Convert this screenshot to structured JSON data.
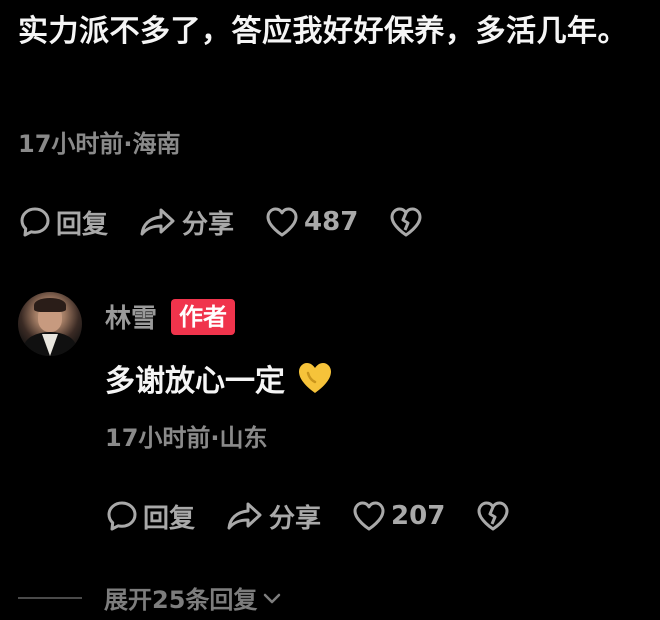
{
  "comment": {
    "text": "实力派不多了，答应我好好保养，多活几年。",
    "meta": "17小时前·海南",
    "actions": {
      "reply_label": "回复",
      "share_label": "分享",
      "like_count": "487"
    }
  },
  "reply": {
    "author": "林雪",
    "badge": "作者",
    "text": "多谢放心一定",
    "emoji": "yellow-heart-icon",
    "meta": "17小时前·山东",
    "actions": {
      "reply_label": "回复",
      "share_label": "分享",
      "like_count": "207"
    }
  },
  "expand_label": "展开25条回复",
  "colors": {
    "background": "#000000",
    "badge": "#f0344c",
    "secondary_text": "#8a8a8a",
    "emoji_heart": "#f6c33a"
  }
}
